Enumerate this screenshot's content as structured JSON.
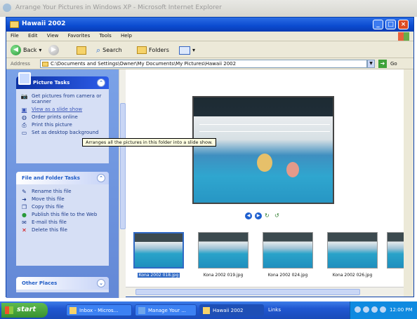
{
  "ie_title": "Arrange Your Pictures in Windows XP - Microsoft Internet Explorer",
  "window": {
    "title": "Hawaii 2002"
  },
  "menu": [
    "File",
    "Edit",
    "View",
    "Favorites",
    "Tools",
    "Help"
  ],
  "toolbar": {
    "back": "Back",
    "search": "Search",
    "folders": "Folders"
  },
  "address": {
    "label": "Address",
    "value": "C:\\Documents and Settings\\Owner\\My Documents\\My Pictures\\Hawaii 2002",
    "go": "Go"
  },
  "picture_tasks": {
    "title": "Picture Tasks",
    "items": [
      {
        "label": "Get pictures from camera or scanner",
        "icon": "camera-icon"
      },
      {
        "label": "View as a slide show",
        "icon": "slideshow-icon"
      },
      {
        "label": "Order prints online",
        "icon": "globe-icon"
      },
      {
        "label": "Print this picture",
        "icon": "printer-icon"
      },
      {
        "label": "Set as desktop background",
        "icon": "desktop-icon"
      }
    ]
  },
  "file_tasks": {
    "title": "File and Folder Tasks",
    "items": [
      {
        "label": "Rename this file",
        "icon": "rename-icon"
      },
      {
        "label": "Move this file",
        "icon": "move-icon"
      },
      {
        "label": "Copy this file",
        "icon": "copy-icon"
      },
      {
        "label": "Publish this file to the Web",
        "icon": "publish-icon"
      },
      {
        "label": "E-mail this file",
        "icon": "email-icon"
      },
      {
        "label": "Delete this file",
        "icon": "delete-icon"
      }
    ]
  },
  "other_places": {
    "title": "Other Places"
  },
  "tooltip": "Arranges all the pictures in this folder into a slide show.",
  "thumbnails": [
    {
      "name": "Kona 2002 018.jpg",
      "selected": true
    },
    {
      "name": "Kona 2002 019.jpg",
      "selected": false
    },
    {
      "name": "Kona 2002 024.jpg",
      "selected": false
    },
    {
      "name": "Kona 2002 026.jpg",
      "selected": false
    }
  ],
  "taskbar": {
    "start": "start",
    "apps": [
      "Inbox - Micros...",
      "Manage Your ...",
      "Hawaii 2002"
    ],
    "links": "Links",
    "clock": "12:00 PM"
  }
}
